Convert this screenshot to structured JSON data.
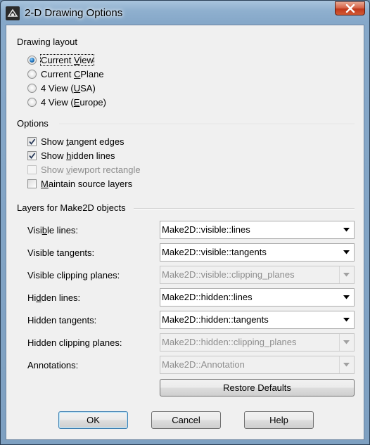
{
  "window": {
    "title": "2-D Drawing Options"
  },
  "drawing_layout": {
    "label": "Drawing layout",
    "options": [
      {
        "pre": "Current ",
        "acc": "V",
        "post": "iew",
        "selected": true
      },
      {
        "pre": "Current ",
        "acc": "C",
        "post": "Plane",
        "selected": false
      },
      {
        "pre": "4 View (",
        "acc": "U",
        "post": "SA)",
        "selected": false
      },
      {
        "pre": "4 View (",
        "acc": "E",
        "post": "urope)",
        "selected": false
      }
    ]
  },
  "options": {
    "label": "Options",
    "items": [
      {
        "pre": "Show ",
        "acc": "t",
        "post": "angent edges",
        "checked": true,
        "enabled": true
      },
      {
        "pre": "Show ",
        "acc": "h",
        "post": "idden lines",
        "checked": true,
        "enabled": true
      },
      {
        "pre": "Show ",
        "acc": "v",
        "post": "iewport rectangle",
        "checked": false,
        "enabled": false
      },
      {
        "pre": "",
        "acc": "M",
        "post": "aintain source layers",
        "checked": false,
        "enabled": true
      }
    ]
  },
  "layers": {
    "label": "Layers for Make2D objects",
    "rows": [
      {
        "pre": "Visi",
        "acc": "b",
        "post": "le lines:",
        "value": "Make2D::visible::lines",
        "enabled": true
      },
      {
        "pre": "Visible tangents:",
        "acc": "",
        "post": "",
        "value": "Make2D::visible::tangents",
        "enabled": true
      },
      {
        "pre": "Visible clipping planes:",
        "acc": "",
        "post": "",
        "value": "Make2D::visible::clipping_planes",
        "enabled": false
      },
      {
        "pre": "Hi",
        "acc": "d",
        "post": "den lines:",
        "value": "Make2D::hidden::lines",
        "enabled": true
      },
      {
        "pre": "Hidden tangents:",
        "acc": "",
        "post": "",
        "value": "Make2D::hidden::tangents",
        "enabled": true
      },
      {
        "pre": "Hidden clipping planes:",
        "acc": "",
        "post": "",
        "value": "Make2D::hidden::clipping_planes",
        "enabled": false
      },
      {
        "pre": "Annotations:",
        "acc": "",
        "post": "",
        "value": "Make2D::Annotation",
        "enabled": false
      }
    ],
    "restore_label": "Restore Defaults"
  },
  "buttons": {
    "ok": "OK",
    "cancel": "Cancel",
    "help": "Help"
  }
}
